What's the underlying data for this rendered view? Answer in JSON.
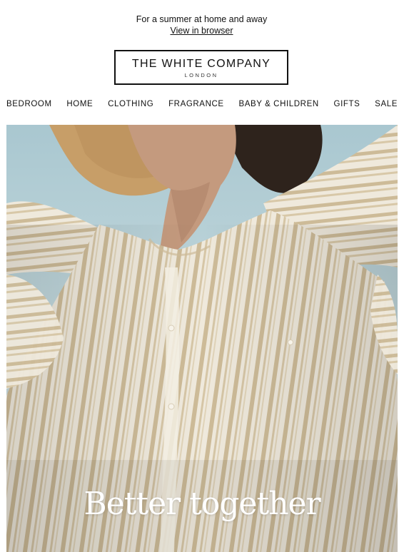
{
  "preheader": {
    "tagline": "For a summer at home and away",
    "view_in_browser": "View in browser"
  },
  "logo": {
    "name": "THE WHITE COMPANY",
    "city": "LONDON"
  },
  "nav": {
    "items": [
      {
        "label": "BEDROOM"
      },
      {
        "label": "HOME"
      },
      {
        "label": "CLOTHING"
      },
      {
        "label": "FRAGRANCE"
      },
      {
        "label": "BABY & CHILDREN"
      },
      {
        "label": "GIFTS"
      },
      {
        "label": "SALE"
      }
    ]
  },
  "hero": {
    "headline": "Better together"
  },
  "colors": {
    "sky": "#b9d2d8",
    "sea": "#4b6f82",
    "shirt": "#ece5d6",
    "stripe": "#c9b796",
    "hat": "#c9a06a",
    "skin": "#c49a7e",
    "hair": "#2c211a"
  }
}
